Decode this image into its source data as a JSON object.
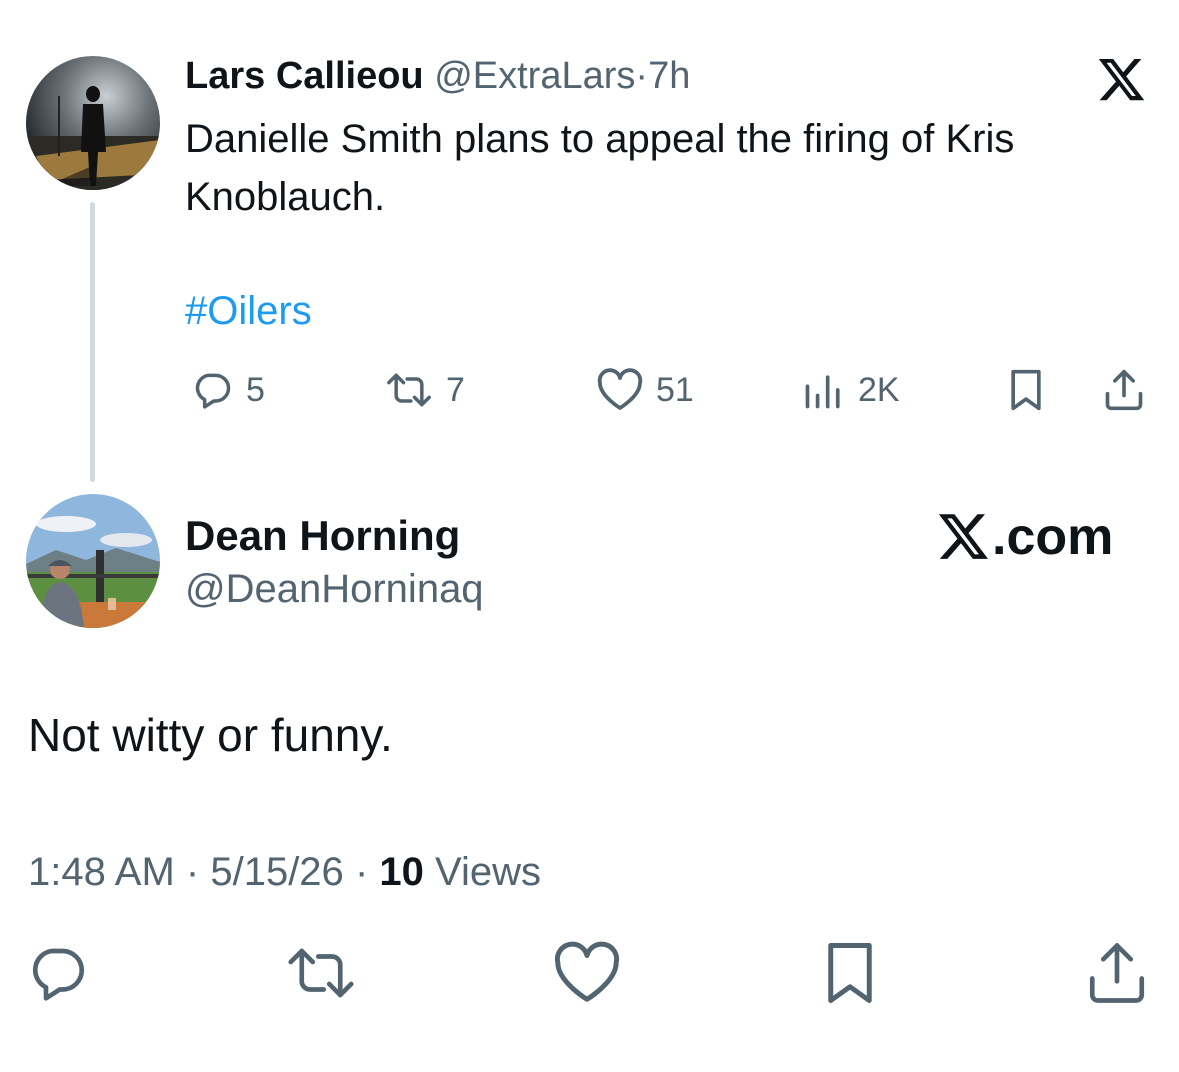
{
  "parent_tweet": {
    "author_name": "Lars Callieou",
    "handle": "@ExtraLars",
    "separator": "·",
    "time": "7h",
    "text": "Danielle Smith plans to appeal the firing of Kris Knoblauch.",
    "hashtag": "#Oilers",
    "actions": {
      "replies": "5",
      "reposts": "7",
      "likes": "51",
      "views": "2K"
    }
  },
  "reply_tweet": {
    "author_name": "Dean Horning",
    "handle": "@DeanHorninaq",
    "text": "Not witty or funny.",
    "time": "1:48 AM",
    "date": "5/15/26",
    "views_count": "10",
    "views_label": "Views",
    "separator": "·"
  },
  "brand": {
    "domain_label": ".com"
  },
  "colors": {
    "text": "#0f1419",
    "muted": "#536471",
    "link": "#1d9bf0",
    "thread_line": "#cfd9de"
  },
  "icons": {
    "x_logo": "x-logo-icon",
    "reply": "reply-icon",
    "repost": "repost-icon",
    "like": "heart-icon",
    "views": "views-chart-icon",
    "bookmark": "bookmark-icon",
    "share": "share-icon"
  }
}
